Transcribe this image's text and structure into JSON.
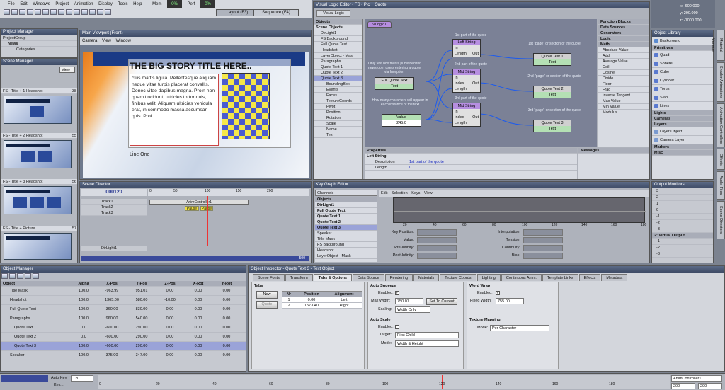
{
  "menu": {
    "items": [
      "File",
      "Edit",
      "Windows",
      "Project",
      "Animation",
      "Display",
      "Tools",
      "Help"
    ],
    "mem": "Mem",
    "mem_val": "0%",
    "perf": "Perf",
    "perf_val": "0%",
    "layout_tab": "Layout (F3)",
    "sequence_tab": "Sequence (F4)"
  },
  "project_manager": {
    "title": "Project Manager",
    "items": [
      "ProjectGroup",
      "News",
      "Categories"
    ]
  },
  "scene_manager": {
    "title": "Scene Manager",
    "view": "View",
    "scenes": [
      {
        "name": "FS - Title + 1 Headshot",
        "num": "38"
      },
      {
        "name": "FS - Title + 2 Headshot",
        "num": "55"
      },
      {
        "name": "FS - Title + 3 Headshot",
        "num": "56"
      },
      {
        "name": "FS - Title + Picture",
        "num": "57"
      }
    ]
  },
  "viewport": {
    "title": "Main Viewport (Front)",
    "menu": [
      "Camera",
      "View",
      "Window"
    ],
    "headline": "THE BIG STORY TITLE HERE..",
    "body": "ctus mattis ligula. Pellentesque aliquam neque vitae turpis placerat convallis. Donec vitae dapibus magna. Proin non quam tincidunt, ultricies tortor quis, finibus velit. Aliquam ultricies vehicula erat, in commodo massa accumsan quis. Proi",
    "line_one": "Line One"
  },
  "scene_director": {
    "title": "Scene Director",
    "frame": "000120",
    "tracks": [
      "Track1",
      "Track2",
      "Track3"
    ],
    "anim": "AnimController1",
    "pause1": "Pause",
    "pause2": "Pause",
    "ruler": [
      "0",
      "50",
      "100",
      "150",
      "200"
    ],
    "dirlight": "DirLight1",
    "end": "500"
  },
  "visual_logic": {
    "title": "Visual Logic Editor - FS - Pic + Quote",
    "tab": "Visual Logic",
    "objects_title": "Objects",
    "scene_objects": "Scene Objects",
    "objects": [
      "DirLight1",
      "FS Background",
      "Full Quote Text",
      "Headshot",
      "LayerObject - Mas",
      "Paragraphs",
      "Quote Text 1",
      "Quote Text 2",
      "Quote Text 3",
      "BoundingBox",
      "Events",
      "Faces",
      "TextureCoords",
      "Pivot",
      "Position",
      "Rotation",
      "Scale",
      "Name",
      "Text"
    ],
    "graph_tab": "VLogic1",
    "nodes": {
      "left": "Left String",
      "mid1": "Mid String",
      "mid2": "Mid String",
      "fullquote": "Full Quote Text",
      "value": "Value",
      "value_num": "245.0",
      "qt1": "Quote Text 1",
      "qt2": "Quote Text 2",
      "qt3": "Quote Text 3",
      "text": "Text",
      "in": "In",
      "length": "Length",
      "index": "Index",
      "out": "Out"
    },
    "notes": [
      "1st part of the quote",
      "2nd part of the quote",
      "3rd part of the quote",
      "Only text box that is published for newsroom users entering a quote via Inception",
      "How many characters will appear in each instance of the text",
      "1st \"page\" or section of the quote",
      "2nd \"page\" or section of the quote",
      "3rd \"page\" or section of the quote"
    ],
    "properties_title": "Properties",
    "prop_node": "Left String",
    "prop_desc": "Description",
    "prop_desc_val": "1st part of the quote",
    "prop_len": "Length",
    "prop_len_val": "0",
    "messages": "Messages"
  },
  "function_blocks": {
    "title": "Function Blocks",
    "cats": [
      "Data Sources",
      "Generators",
      "Logic",
      "Math"
    ],
    "items": [
      "Absolute Value",
      "Add",
      "Average Value",
      "Ceil",
      "Cosine",
      "Divide",
      "Floor",
      "Frac",
      "Inverse Tangent",
      "Max Value",
      "Min Value",
      "Modulus"
    ]
  },
  "key_graph": {
    "title": "Key Graph Editor",
    "channels": "Channels",
    "tabs": [
      "Edit",
      "Selection",
      "Keys",
      "View"
    ],
    "objects_label": "Objects",
    "objects": [
      "DirLight1",
      "Full Quote Text",
      "Quote Text 1",
      "Quote Text 2",
      "Quote Text 3",
      "Speaker",
      "Title Mask",
      "FS Background",
      "Headshot",
      "LayerObject - Mask"
    ],
    "xticks": [
      "20",
      "40",
      "60",
      "80",
      "100",
      "120",
      "140",
      "160",
      "180"
    ],
    "fields_left": [
      "Key Position:",
      "Value:",
      "Pre-Infinity:",
      "Post-Infinity:"
    ],
    "fields_right": [
      "Interpolation:",
      "Tension:",
      "Continuity:",
      "Bias:"
    ]
  },
  "object_library": {
    "title": "Object Library",
    "items": [
      "Background"
    ],
    "primitives": "Primitives",
    "prim_items": [
      "Quad",
      "Sphere",
      "Cube",
      "Cylinder",
      "Torus",
      "Slab",
      "Lines"
    ],
    "lights": "Lights",
    "cameras": "Cameras",
    "layers": "Layers",
    "layer_items": [
      "Layer Object",
      "Camera Layer"
    ],
    "markers": "Markers",
    "misc": "Misc"
  },
  "output_monitors": {
    "title": "Output Monitors",
    "vals": [
      "3",
      "2",
      "1",
      "0",
      "-1",
      "-2",
      "-3"
    ],
    "virtual": "2: Virtual Output",
    "vvals": [
      "-1",
      "-2",
      "-3"
    ]
  },
  "coords": {
    "x": "x: -600.000",
    "y": "y: 290.000",
    "z": "z: -1000.000"
  },
  "right_tabs": [
    "Material Manager",
    "Shader Animations",
    "Animation Controllers",
    "Effects",
    "Audio Files",
    "Scene Directors"
  ],
  "object_manager": {
    "title": "Object Manager",
    "cols": [
      "Object",
      "Alpha",
      "X-Pos",
      "Y-Pos",
      "Z-Pos",
      "X-Rot",
      "Y-Rot"
    ],
    "rows": [
      {
        "name": "Title Mask",
        "alpha": "100.0",
        "x": "-963.99",
        "y": "951.01",
        "z": "0.00",
        "xr": "0.00",
        "yr": "0.00"
      },
      {
        "name": "Headshot",
        "alpha": "100.0",
        "x": "1365.00",
        "y": "580.00",
        "z": "-10.00",
        "xr": "0.00",
        "yr": "0.00"
      },
      {
        "name": "Full Quote Text",
        "alpha": "100.0",
        "x": "360.00",
        "y": "830.00",
        "z": "0.00",
        "xr": "0.00",
        "yr": "0.00"
      },
      {
        "name": "Paragraphs",
        "alpha": "100.0",
        "x": "960.00",
        "y": "540.00",
        "z": "0.00",
        "xr": "0.00",
        "yr": "0.00"
      },
      {
        "name": "Quote Text 1",
        "alpha": "0.0",
        "x": "-600.00",
        "y": "290.00",
        "z": "0.00",
        "xr": "0.00",
        "yr": "0.00"
      },
      {
        "name": "Quote Text 2",
        "alpha": "0.0",
        "x": "-600.00",
        "y": "290.00",
        "z": "0.00",
        "xr": "0.00",
        "yr": "0.00"
      },
      {
        "name": "Quote Text 3",
        "alpha": "100.0",
        "x": "-600.00",
        "y": "290.00",
        "z": "0.00",
        "xr": "0.00",
        "yr": "0.00"
      },
      {
        "name": "Speaker",
        "alpha": "100.0",
        "x": "375.00",
        "y": "347.00",
        "z": "0.00",
        "xr": "0.00",
        "yr": "0.00"
      }
    ]
  },
  "inspector": {
    "title": "Object Inspector - Quote Text 3 - Text Object",
    "tabs": [
      "Scene Fonts",
      "Transform",
      "Tabs & Options",
      "Data Source",
      "Rendering",
      "Materials",
      "Texture Coords",
      "Lighting",
      "Continuous Anim.",
      "Template Links",
      "Effects",
      "Metadata"
    ],
    "tabs_section": "Tabs",
    "new_btn": "New",
    "quote_btn": "Quote",
    "tab_cols": [
      "Nr",
      "Position",
      "Alignment"
    ],
    "tab_rows": [
      [
        "1",
        "0.00",
        "Left"
      ],
      [
        "2",
        "1573.40",
        "Right"
      ]
    ],
    "auto_squeeze": "Auto Squeeze",
    "enabled": "Enabled:",
    "max_width": "Max Width:",
    "max_width_val": "750.07",
    "set_current": "Set To Current",
    "scaling": "Scaling:",
    "scaling_val": "Width Only",
    "auto_scale": "Auto Scale",
    "target": "Target:",
    "target_val": "First Child",
    "mode": "Mode:",
    "mode_val": "Width & Height",
    "word_wrap": "Word Wrap",
    "fixed_width": "Fixed Width:",
    "fixed_width_val": "755.00",
    "texture_mapping": "Texture Mapping",
    "tm_mode_val": "Per Character"
  },
  "bottom": {
    "auto_key": "Auto Key",
    "frame": "120",
    "key": "Key...",
    "ruler": [
      "0",
      "20",
      "40",
      "60",
      "80",
      "100",
      "120",
      "140",
      "160",
      "180"
    ],
    "anim": "AnimController1",
    "v1": "200",
    "v2": "200"
  },
  "colors": {
    "title_bar": "#3e4b66",
    "node_purple": "#b68ee0",
    "node_green": "#b4e0b4",
    "graph_bg": "#7b8196"
  }
}
